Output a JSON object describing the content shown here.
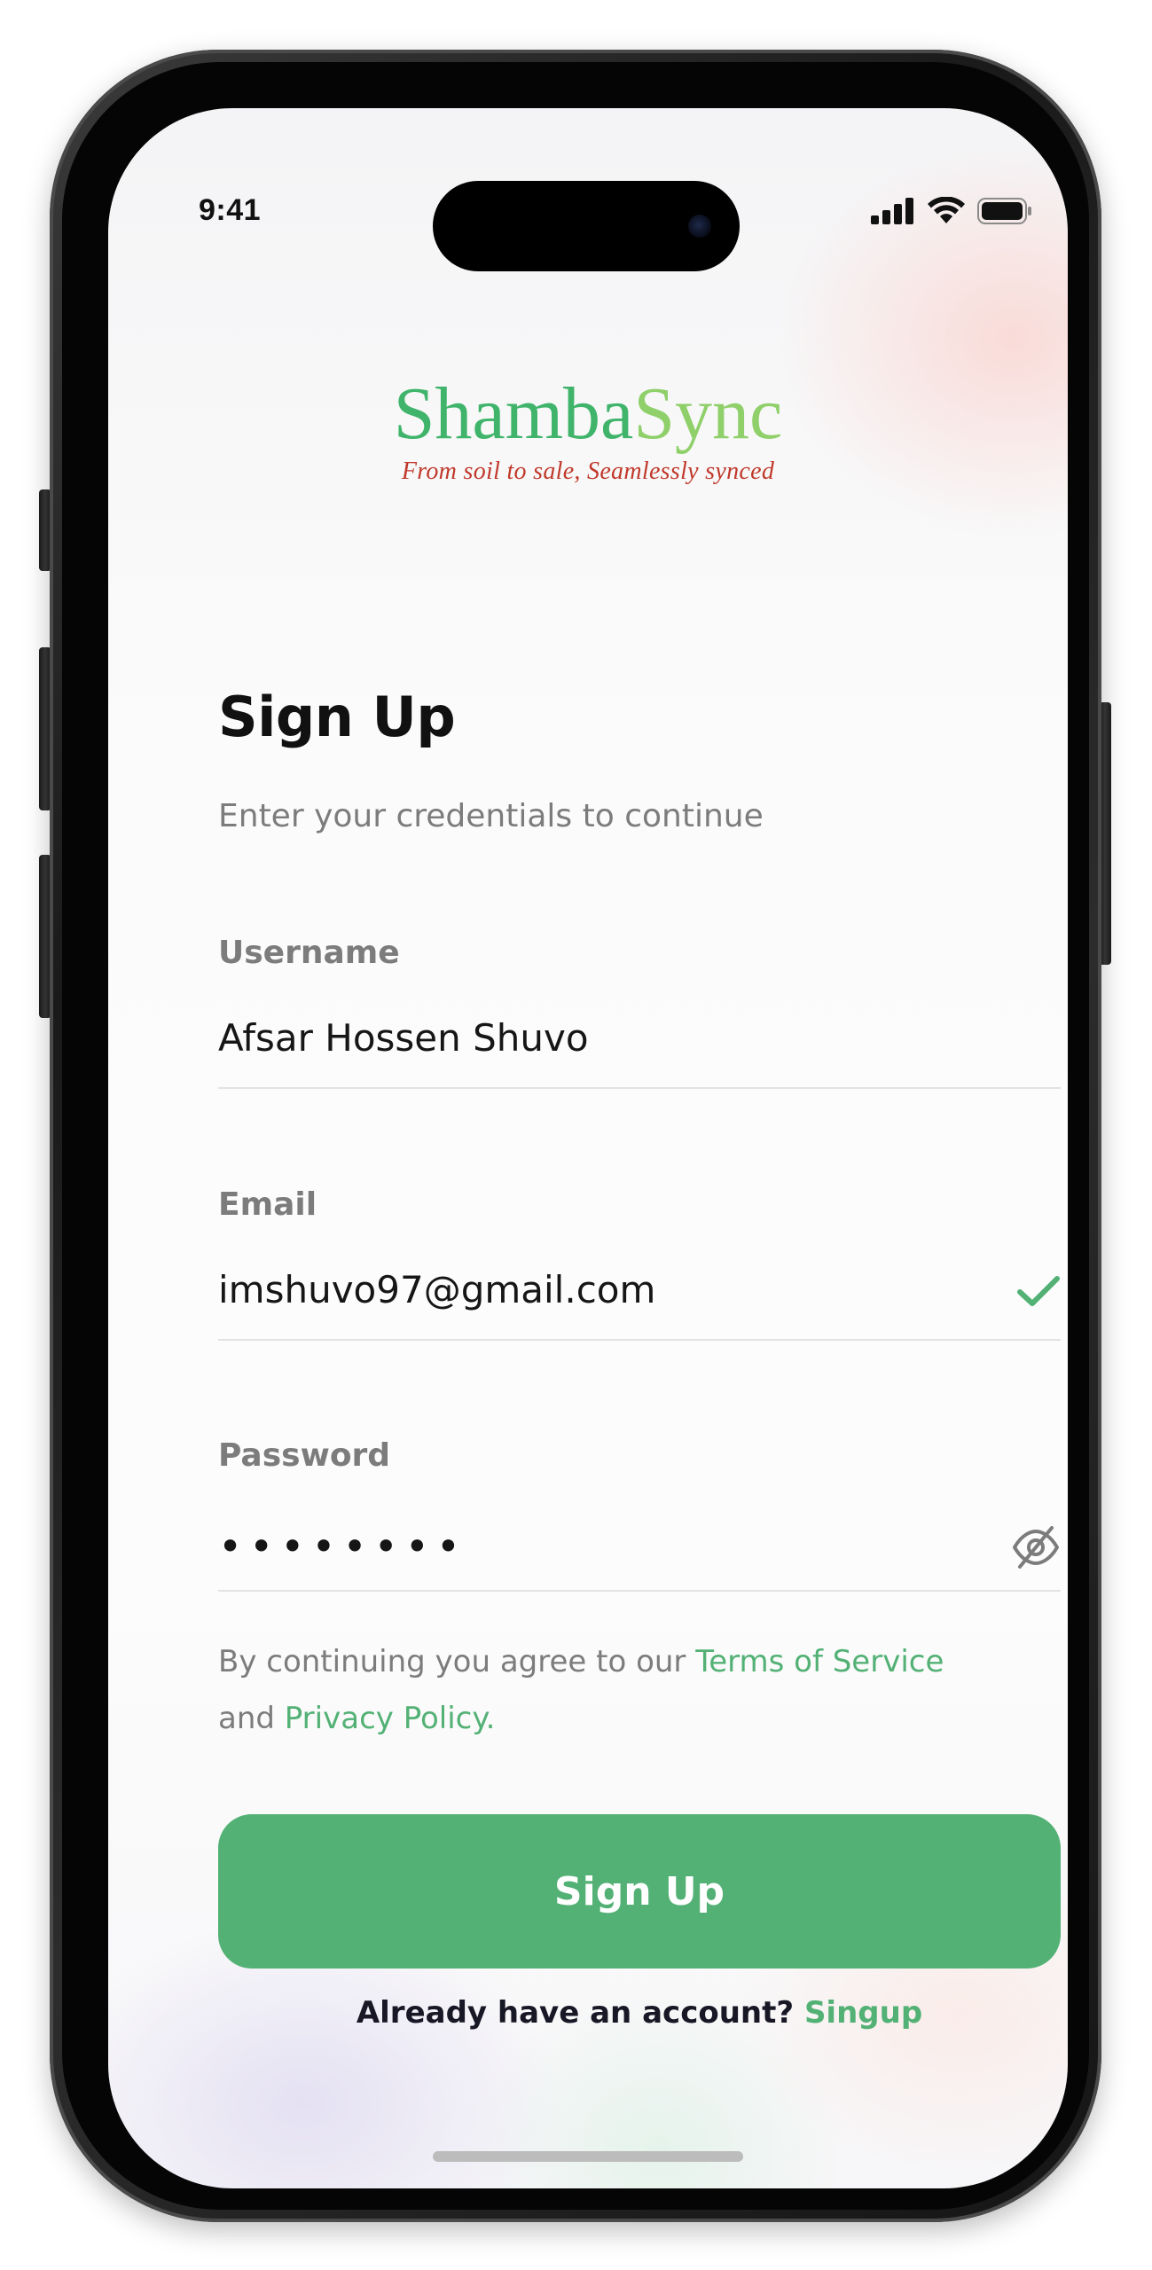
{
  "status_bar": {
    "time": "9:41",
    "icons": [
      "cellular-signal-icon",
      "wifi-icon",
      "battery-icon"
    ]
  },
  "logo": {
    "title_part1": "Shamba",
    "title_part2": "Sync",
    "tagline": "From soil to sale, Seamlessly synced"
  },
  "page": {
    "title": "Sign Up",
    "subtitle": "Enter your credentials to continue"
  },
  "form": {
    "username": {
      "label": "Username",
      "value": "Afsar Hossen Shuvo"
    },
    "email": {
      "label": "Email",
      "value": "imshuvo97@gmail.com",
      "status_icon": "check-icon"
    },
    "password": {
      "label": "Password",
      "value": "••••••••",
      "toggle_icon": "eye-off-icon"
    }
  },
  "terms": {
    "prefix": "By continuing you agree to our ",
    "terms_link": "Terms of Service",
    "middle": "and ",
    "privacy_link": "Privacy Policy."
  },
  "actions": {
    "submit_label": "Sign Up"
  },
  "footer": {
    "prompt": "Already have an account? ",
    "link": "Singup"
  },
  "colors": {
    "accent": "#53b175",
    "logo_green": "#3fb46a",
    "logo_light_green": "#8fd06a",
    "tagline_red": "#c0392b",
    "text_dark": "#161616",
    "text_muted": "#7c7c7c"
  }
}
